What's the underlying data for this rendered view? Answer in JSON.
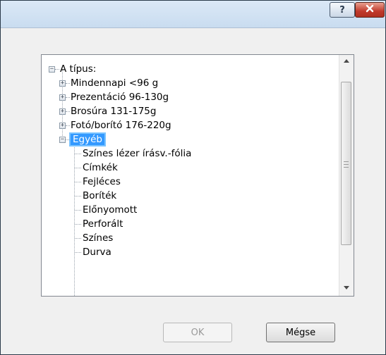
{
  "titlebar": {
    "help_icon": "?",
    "close_icon": "x"
  },
  "tree": {
    "root": {
      "label": "A típus:",
      "expanded": true,
      "children": [
        {
          "label": "Mindennapi <96 g",
          "expanded": false
        },
        {
          "label": "Prezentáció 96-130g",
          "expanded": false
        },
        {
          "label": "Brosúra 131-175g",
          "expanded": false
        },
        {
          "label": "Fotó/borító 176-220g",
          "expanded": false
        },
        {
          "label": "Egyéb",
          "expanded": true,
          "selected": true,
          "children": [
            "Színes lézer írásv.-fólia",
            "Címkék",
            "Fejléces",
            "Boríték",
            "Előnyomott",
            "Perforált",
            "Színes",
            "Durva"
          ]
        }
      ]
    }
  },
  "buttons": {
    "ok_label": "OK",
    "ok_enabled": false,
    "cancel_label": "Mégse"
  },
  "scrollbar": {
    "up_icon": "triangle-up",
    "down_icon": "triangle-down"
  }
}
